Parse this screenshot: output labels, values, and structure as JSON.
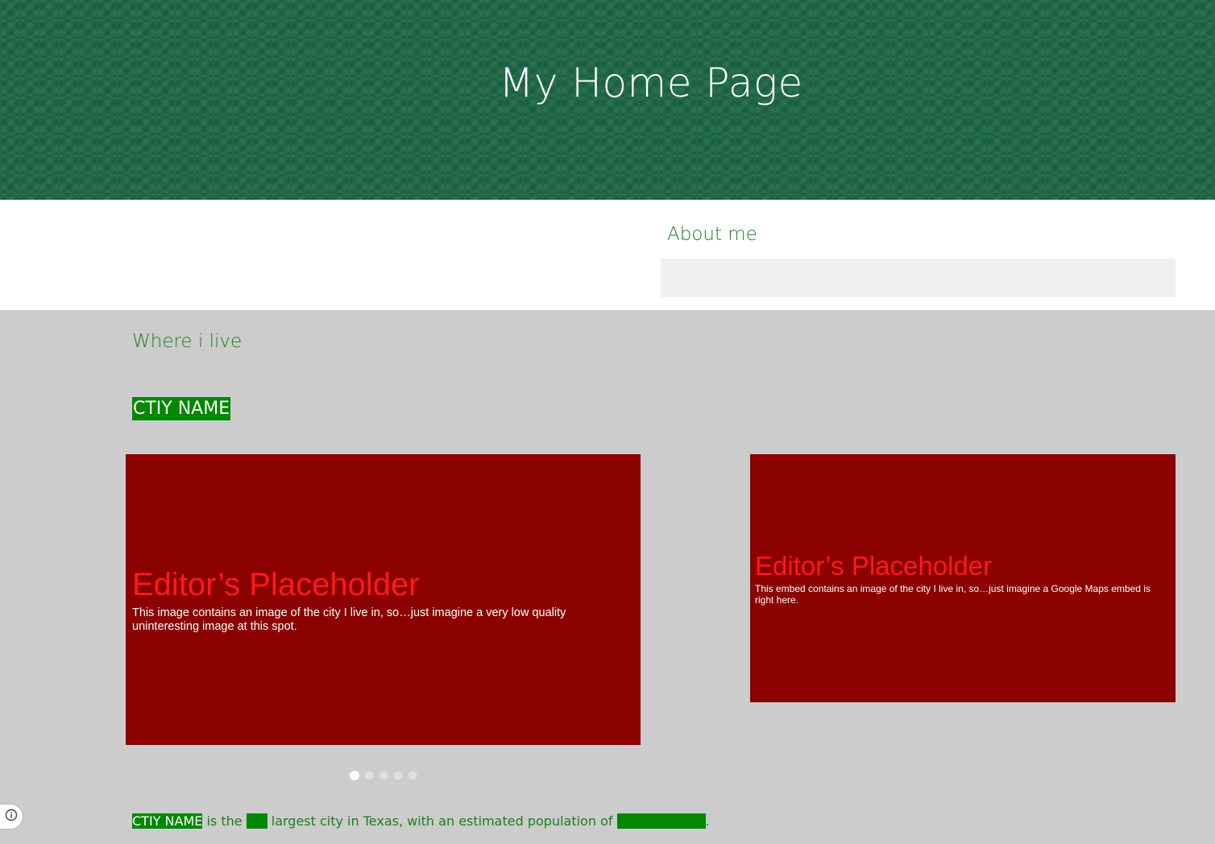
{
  "header": {
    "title": "My Home Page"
  },
  "about": {
    "heading": "About me"
  },
  "where_i_live": {
    "heading": "Where i live",
    "city_name": "CTIY NAME",
    "image_placeholder": {
      "title": "Editor’s Placeholder",
      "description": "This image contains an image of the city I live in, so…just imagine a very low quality uninteresting image at this spot."
    },
    "embed_placeholder": {
      "title": "Editor’s Placeholder",
      "description": "This embed contains an image of the city I live in, so…just imagine a Google Maps embed is right here."
    },
    "carousel": {
      "slide_count": 5,
      "active_index": 0
    },
    "fact": {
      "city_name": "CTIY NAME",
      "text_1": " is the ",
      "text_2": " largest city in Texas, with an estimated population of ",
      "text_3": "."
    }
  },
  "colors": {
    "header_bg": "#1b6642",
    "accent_green": "#008800",
    "heading_green": "#1e7d1e",
    "placeholder_bg": "#8b0000",
    "placeholder_title": "#ff1a1a"
  },
  "icons": {
    "info_button": "info-icon"
  }
}
